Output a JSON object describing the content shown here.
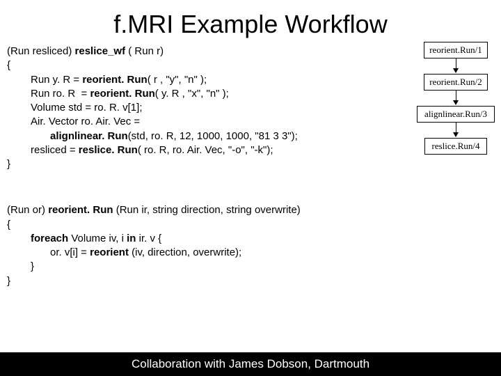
{
  "title": "f.MRI Example Workflow",
  "code1": {
    "sig_pre": "(Run resliced) ",
    "sig_name": "reslice_wf",
    "sig_post": " ( Run r)",
    "open": "{",
    "l1a": "Run y. R = ",
    "l1b": "reorient. Run",
    "l1c": "( r , \"y\", \"n\" );",
    "l2a": "Run ro. R  = ",
    "l2b": "reorient. Run",
    "l2c": "( y. R , \"x\", \"n\" );",
    "l3": "Volume std = ro. R. v[1];",
    "l4": "Air. Vector ro. Air. Vec =",
    "l5a": "alignlinear. Run",
    "l5b": "(std, ro. R, 12, 1000, 1000, \"81 3 3\");",
    "l6a": "resliced = ",
    "l6b": "reslice. Run",
    "l6c": "( ro. R, ro. Air. Vec, \"-o\", \"-k\");",
    "close": "}"
  },
  "code2": {
    "sig_pre": "(Run or) ",
    "sig_name": "reorient. Run ",
    "sig_post": "(Run ir, string direction, string overwrite)",
    "open": "{",
    "l1a": "foreach ",
    "l1b": "Volume iv, i ",
    "l1c": "in ",
    "l1d": "ir. v {",
    "l2a": "or. v[i] = ",
    "l2b": "reorient ",
    "l2c": "(iv, direction, overwrite);",
    "l3": "}",
    "close": "}"
  },
  "diagram": {
    "n1": "reorient.Run/1",
    "n2": "reorient.Run/2",
    "n3": "alignlinear.Run/3",
    "n4": "reslice.Run/4"
  },
  "footer": "Collaboration with James Dobson, Dartmouth"
}
